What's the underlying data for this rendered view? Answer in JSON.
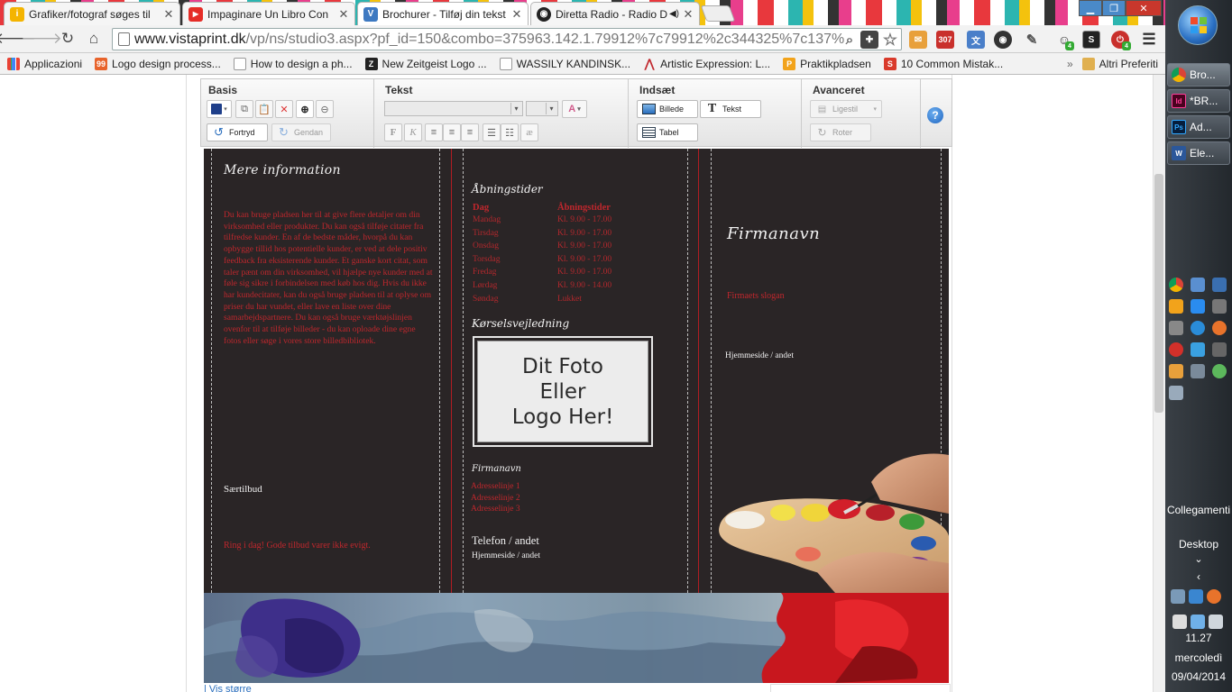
{
  "tabs": [
    {
      "title": "Grafiker/fotograf søges til",
      "fav_color": "#f4b400",
      "fav_glyph": "i"
    },
    {
      "title": "Impaginare Un Libro Con",
      "fav_color": "#e52d27",
      "fav_glyph": "▶"
    },
    {
      "title": "Brochurer - Tilføj din tekst",
      "fav_color": "#3d79c1",
      "fav_glyph": "V"
    },
    {
      "title": "Diretta Radio - Radio D",
      "fav_color": "#222222",
      "fav_glyph": "◉"
    }
  ],
  "address": {
    "url_host": "www.vistaprint.dk",
    "url_path": "/vp/ns/studio3.aspx?pf_id=150&combo=375963.142.1.79912%7c79912%2c344325%7c137%"
  },
  "extensions": {
    "badge_count": "307",
    "badge_small_1": "4",
    "badge_small_2": "4"
  },
  "bookmarks": [
    {
      "label": "Applicazioni",
      "icon": "apps-grid-icon",
      "color": "#e94235"
    },
    {
      "label": "Logo design process...",
      "icon": "99designs-icon",
      "color": "#e8632b"
    },
    {
      "label": "How to design a ph...",
      "icon": "page-icon",
      "color": "#ffffff"
    },
    {
      "label": "New Zeitgeist Logo ...",
      "icon": "zeitgeist-icon",
      "color": "#222222"
    },
    {
      "label": "WASSILY KANDINSK...",
      "icon": "page-icon",
      "color": "#ffffff"
    },
    {
      "label": "Artistic Expression: L...",
      "icon": "artistic-icon",
      "color": "#c0272d"
    },
    {
      "label": "Praktikpladsen",
      "icon": "p-icon",
      "color": "#f2a31b"
    },
    {
      "label": "10 Common Mistak...",
      "icon": "s-icon",
      "color": "#d93a2b"
    }
  ],
  "bookmarks_other": "Altri Preferiti",
  "studio": {
    "groups": {
      "basis": "Basis",
      "tekst": "Tekst",
      "indsaet": "Indsæt",
      "avanceret": "Avanceret"
    },
    "buttons": {
      "fortryd": "Fortryd",
      "gendan": "Gendan",
      "billede": "Billede",
      "tekst": "Tekst",
      "tabel": "Tabel",
      "ligestil": "Ligestil",
      "roter": "Roter"
    },
    "format_glyphs": {
      "bold": "F",
      "italic": "K",
      "special": "æ"
    }
  },
  "brochure": {
    "panel_left": {
      "heading": "Mere information",
      "body": "Du kan bruge pladsen her til at give flere detaljer om din virksomhed eller produkter. Du kan også tilføje citater fra tilfredse kunder. En af de bedste måder, hvorpå du kan opbygge tillid hos potentielle kunder, er ved at dele positiv feedback fra eksisterende kunder. Et ganske kort citat, som taler pænt om din virksomhed, vil hjælpe nye kunder med at føle sig sikre i forbindelsen med køb hos dig. Hvis du ikke har kundecitater, kan du også bruge pladsen til at oplyse om priser du har vundet, eller lave en liste over dine samarbejdspartnere. Du kan også bruge værktøjslinjen ovenfor til at tilføje billeder - du kan oploade dine egne fotos eller søge i vores store billedbibliotek.",
      "offer_title": "Særtilbud",
      "offer_text": "Ring i dag! Gode tilbud varer ikke evigt."
    },
    "panel_middle": {
      "hours_heading": "Åbningstider",
      "hours_col_day": "Dag",
      "hours_col_time": "Åbningstider",
      "hours": [
        {
          "day": "Mandag",
          "time": "Kl. 9.00 - 17.00"
        },
        {
          "day": "Tirsdag",
          "time": "Kl. 9.00 - 17.00"
        },
        {
          "day": "Onsdag",
          "time": "Kl. 9.00 - 17.00"
        },
        {
          "day": "Torsdag",
          "time": "Kl. 9.00 - 17.00"
        },
        {
          "day": "Fredag",
          "time": "Kl. 9.00 - 17.00"
        },
        {
          "day": "Lørdag",
          "time": "Kl. 9.00 - 14.00"
        },
        {
          "day": "Søndag",
          "time": "Lukket"
        }
      ],
      "directions_heading": "Kørselsvejledning",
      "photo_line1": "Dit Foto",
      "photo_line2": "Eller",
      "photo_line3": "Logo Her!",
      "company_small": "Firmanavn",
      "address1": "Adresselinje 1",
      "address2": "Adresselinje 2",
      "address3": "Adresselinje 3",
      "phone": "Telefon / andet",
      "website": "Hjemmeside / andet"
    },
    "panel_right": {
      "company": "Firmanavn",
      "slogan": "Firmaets slogan",
      "website": "Hjemmeside / andet"
    }
  },
  "below_canvas_link": "| Vis større",
  "taskbar": {
    "items": [
      {
        "label": "Bro...",
        "icon": "chrome-icon",
        "color": "#f4b400"
      },
      {
        "label": "*BR...",
        "icon": "indesign-icon",
        "color": "#d63384",
        "glyph": "Id"
      },
      {
        "label": "Ad...",
        "icon": "photoshop-icon",
        "color": "#2f6fb3",
        "glyph": "Ps"
      },
      {
        "label": "Ele...",
        "icon": "word-icon",
        "color": "#2b579a",
        "glyph": "W"
      }
    ],
    "links": "Collegamenti",
    "desktop": "Desktop",
    "time": "11.27",
    "weekday": "mercoledì",
    "date": "09/04/2014"
  }
}
